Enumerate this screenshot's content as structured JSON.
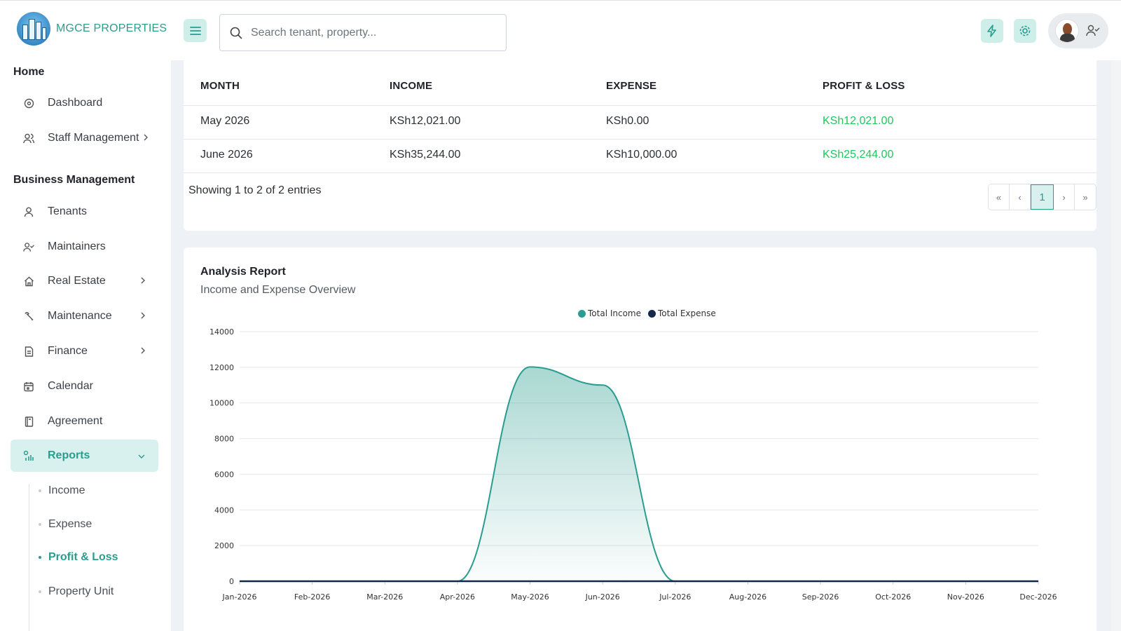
{
  "brand": {
    "name": "MGCE PROPERTIES"
  },
  "search": {
    "placeholder": "Search tenant, property..."
  },
  "header_icons": [
    "bolt-icon",
    "gear-icon",
    "user-check-icon"
  ],
  "sidebar": {
    "home_title": "Home",
    "home_items": [
      {
        "label": "Dashboard",
        "icon": "dashboard-icon"
      },
      {
        "label": "Staff Management",
        "icon": "users-icon",
        "has_submenu": true
      }
    ],
    "business_title": "Business Management",
    "business_items": [
      {
        "label": "Tenants",
        "icon": "user-icon"
      },
      {
        "label": "Maintainers",
        "icon": "user-check-icon"
      },
      {
        "label": "Real Estate",
        "icon": "home-icon",
        "has_submenu": true
      },
      {
        "label": "Maintenance",
        "icon": "wrench-icon",
        "has_submenu": true
      },
      {
        "label": "Finance",
        "icon": "document-icon",
        "has_submenu": true
      },
      {
        "label": "Calendar",
        "icon": "calendar-icon"
      },
      {
        "label": "Agreement",
        "icon": "book-icon"
      },
      {
        "label": "Reports",
        "icon": "reports-icon",
        "active": true,
        "expanded": true
      }
    ],
    "report_subitems": [
      {
        "label": "Income"
      },
      {
        "label": "Expense"
      },
      {
        "label": "Profit & Loss",
        "active": true
      },
      {
        "label": "Property Unit"
      }
    ]
  },
  "table": {
    "headers": [
      "MONTH",
      "INCOME",
      "EXPENSE",
      "PROFIT & LOSS"
    ],
    "rows": [
      [
        "May 2026",
        "KSh12,021.00",
        "KSh0.00",
        "KSh12,021.00"
      ],
      [
        "June 2026",
        "KSh35,244.00",
        "KSh10,000.00",
        "KSh25,244.00"
      ]
    ],
    "entries_text": "Showing 1 to 2 of 2 entries",
    "pagination": {
      "first": "«",
      "prev": "‹",
      "current": "1",
      "next": "›",
      "last": "»"
    }
  },
  "chart_section": {
    "title": "Analysis Report",
    "subtitle": "Income and Expense Overview"
  },
  "colors": {
    "accent": "#2a9d8f",
    "profit_green": "#22c55e",
    "expense_navy": "#13294b"
  },
  "chart_data": {
    "type": "area",
    "categories": [
      "Jan-2026",
      "Feb-2026",
      "Mar-2026",
      "Apr-2026",
      "May-2026",
      "Jun-2026",
      "Jul-2026",
      "Aug-2026",
      "Sep-2026",
      "Oct-2026",
      "Nov-2026",
      "Dec-2026"
    ],
    "series": [
      {
        "name": "Total Income",
        "color": "#2a9d8f",
        "values": [
          0,
          0,
          0,
          0,
          12021,
          11000,
          0,
          0,
          0,
          0,
          0,
          0
        ]
      },
      {
        "name": "Total Expense",
        "color": "#13294b",
        "values": [
          0,
          0,
          0,
          0,
          0,
          0,
          0,
          0,
          0,
          0,
          0,
          0
        ]
      }
    ],
    "yticks": [
      0,
      2000,
      4000,
      6000,
      8000,
      10000,
      12000,
      14000
    ],
    "ylim": [
      0,
      14000
    ],
    "legend": "top-center",
    "grid": true
  }
}
